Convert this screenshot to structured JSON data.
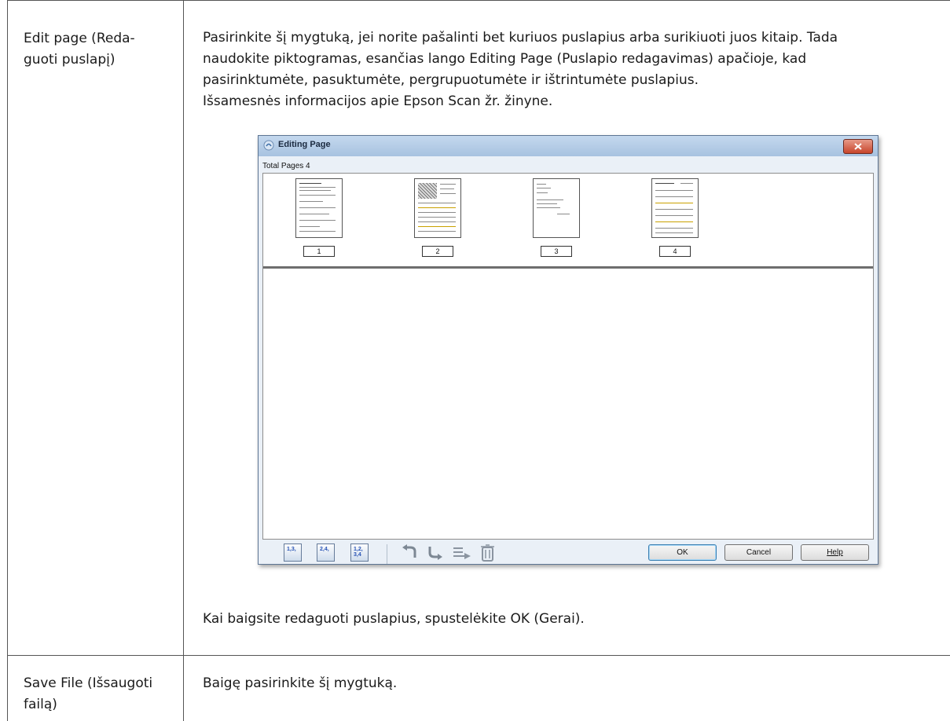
{
  "rows": [
    {
      "label": "Edit page (Reda-\nguoti puslapį)",
      "description": [
        "Pasirinkite šį mygtuką, jei norite pašalinti bet kuriuos puslapius arba surikiuoti juos kitaip. Tada",
        "naudokite piktogramas, esančias lango Editing Page (Puslapio redagavimas) apačioje, kad",
        "pasirinktumėte, pasuktumėte, pergrupuotumėte ir ištrintumėte puslapius.",
        "Išsamesnės informacijos apie Epson Scan žr. žinyne."
      ],
      "after_note": "Kai baigsite redaguoti puslapius, spustelėkite OK (Gerai)."
    },
    {
      "label": "Save File (Išsaugoti\nfailą)",
      "description": [
        "Baigę pasirinkite šį mygtuką."
      ]
    }
  ],
  "dialog": {
    "title": "Editing Page",
    "total_pages_label": "Total Pages 4",
    "pages": [
      "1",
      "2",
      "3",
      "4"
    ],
    "toolbar_icons": [
      "select-odd-pages-icon",
      "select-even-pages-icon",
      "select-all-pages-icon",
      "rotate-left-icon",
      "rotate-right-icon",
      "regroup-pages-icon",
      "delete-page-icon"
    ],
    "odd_label": "1,3,",
    "even_label": "2,4,",
    "all_label": "1,2,\n3,4",
    "ok_label": "OK",
    "cancel_label": "Cancel",
    "help_label": "Help"
  },
  "colors": {
    "table_line": "#555555",
    "titlebar": "#b6cde8",
    "close_button": "#d15a40",
    "icon_blue": "#2853b5"
  }
}
